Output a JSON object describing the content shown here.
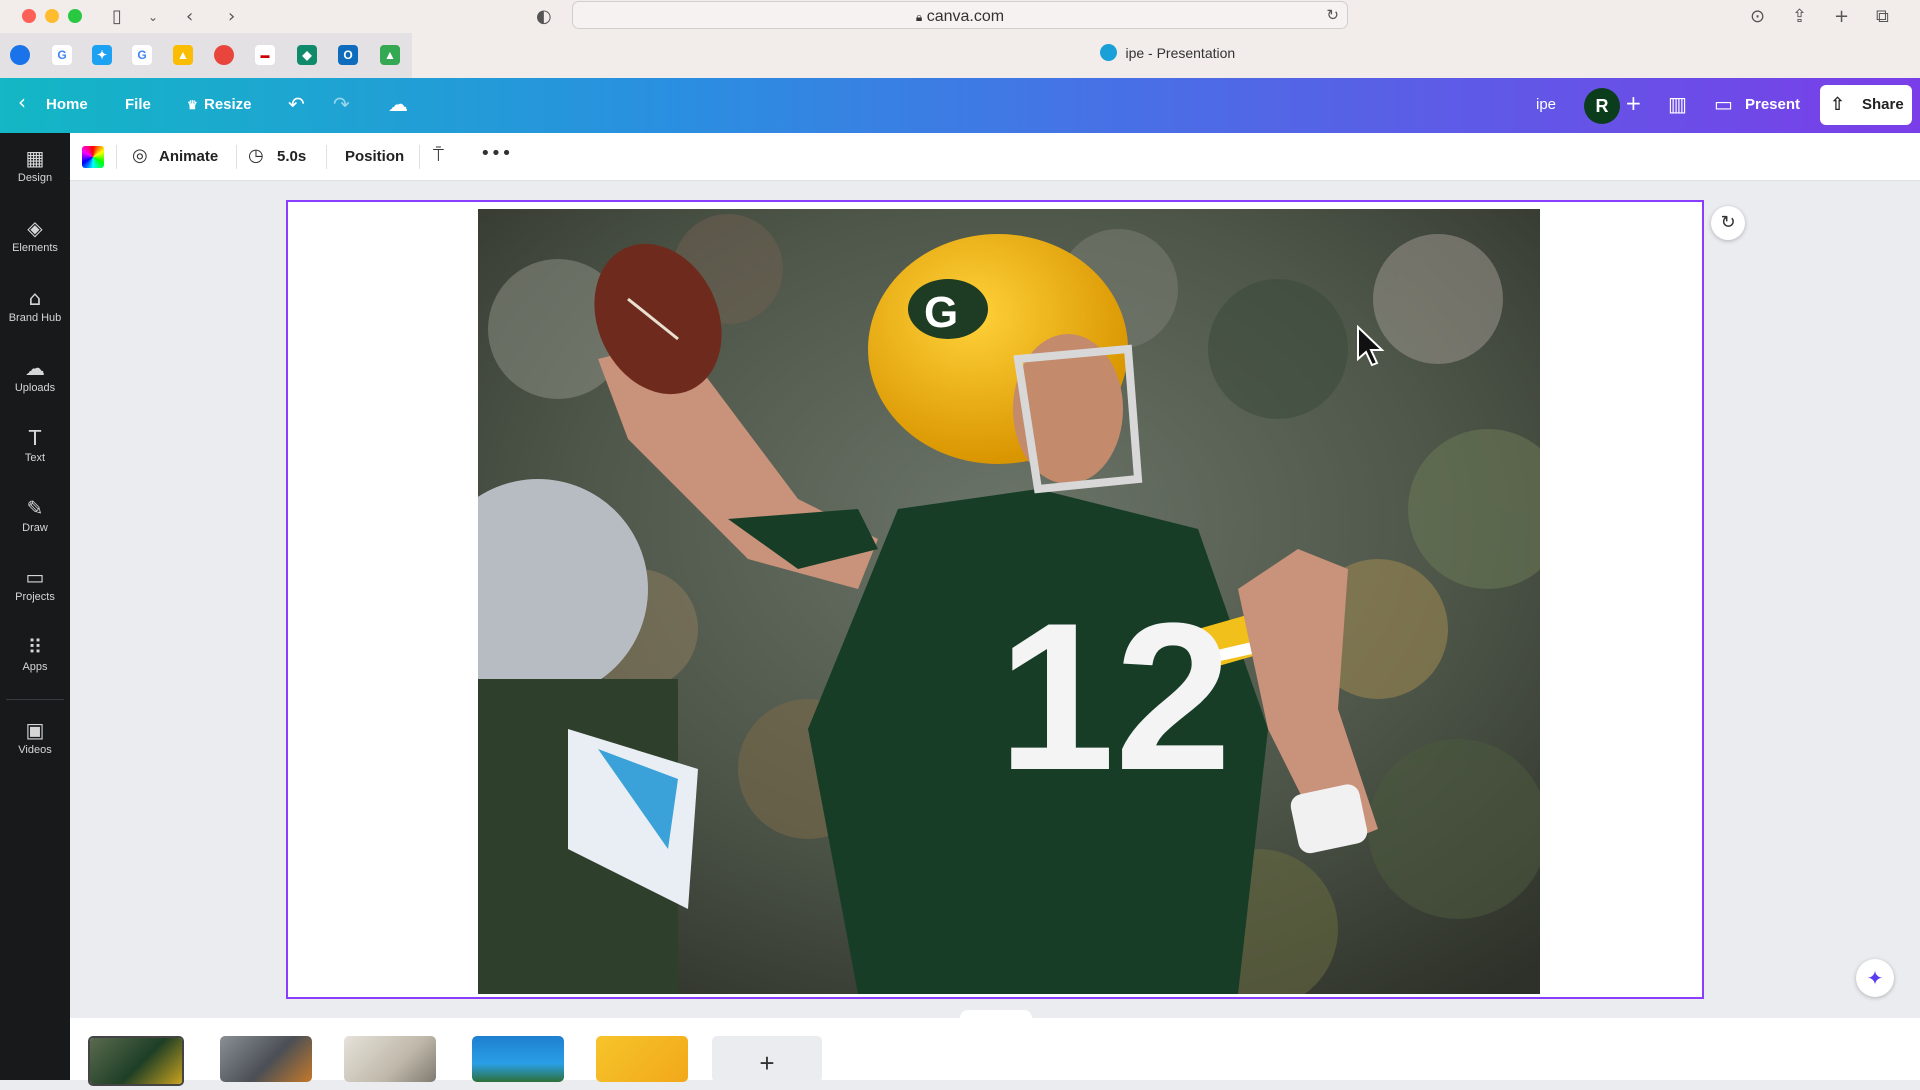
{
  "browser": {
    "address": "canva.com",
    "tab_title": "ipe - Presentation"
  },
  "header": {
    "home_label": "Home",
    "file_label": "File",
    "resize_label": "Resize",
    "design_name": "ipe",
    "avatar_initial": "R",
    "present_label": "Present",
    "share_label": "Share",
    "gradient_colors": [
      "#13b7c5",
      "#2a8fe0",
      "#7a3ee8"
    ]
  },
  "sidebar": {
    "items": [
      {
        "label": "Design",
        "icon": "layout-icon"
      },
      {
        "label": "Elements",
        "icon": "shapes-icon"
      },
      {
        "label": "Brand Hub",
        "icon": "brand-icon"
      },
      {
        "label": "Uploads",
        "icon": "upload-cloud-icon"
      },
      {
        "label": "Text",
        "icon": "text-icon"
      },
      {
        "label": "Draw",
        "icon": "pen-icon"
      },
      {
        "label": "Projects",
        "icon": "folder-icon"
      },
      {
        "label": "Apps",
        "icon": "grid-icon"
      },
      {
        "label": "Videos",
        "icon": "video-icon"
      }
    ]
  },
  "toolbar": {
    "animate_label": "Animate",
    "duration_label": "5.0s",
    "position_label": "Position"
  },
  "canvas": {
    "accent_color": "#8b3dff",
    "image_description_icon": "football-photo"
  },
  "filmstrip": {
    "add_label": "+"
  }
}
